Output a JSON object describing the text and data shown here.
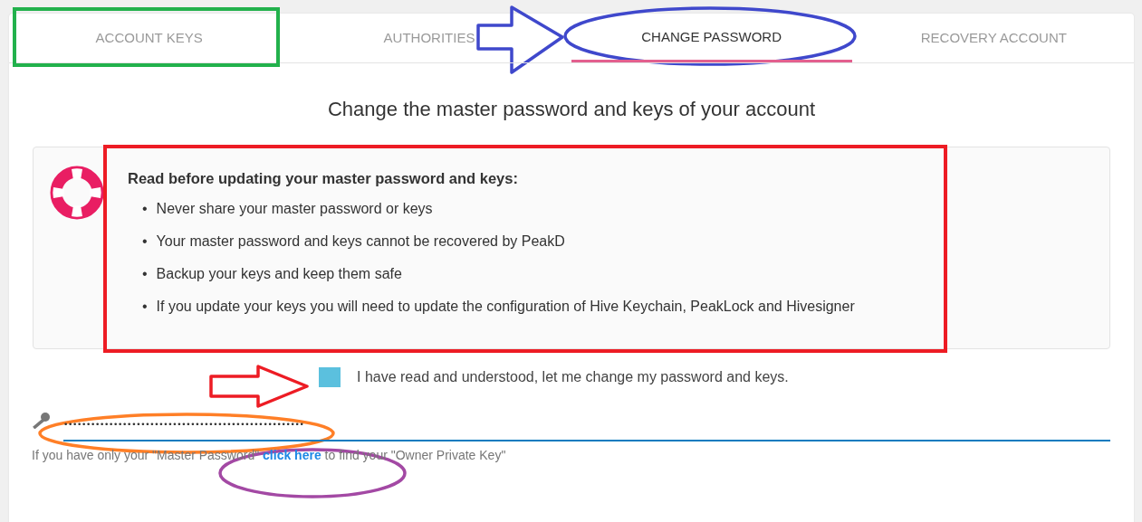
{
  "tabs": [
    {
      "label": "ACCOUNT KEYS",
      "selected": false
    },
    {
      "label": "AUTHORITIES",
      "selected": false
    },
    {
      "label": "CHANGE PASSWORD",
      "selected": true
    },
    {
      "label": "RECOVERY ACCOUNT",
      "selected": false
    }
  ],
  "title": "Change the master password and keys of your account",
  "notice": {
    "heading": "Read before updating your master password and keys:",
    "bullet": "•",
    "items": [
      "Never share your master password or keys",
      "Your master password and keys cannot be recovered by PeakD",
      "Backup your keys and keep them safe",
      "If you update your keys you will need to update the configuration of Hive Keychain, PeakLock and Hivesigner"
    ]
  },
  "agree": {
    "label": "I have read and understood, let me change my password and keys.",
    "checked": true
  },
  "password_field": {
    "value": "•••••••••••••••••••••••••••••••••••••••••••••••••••••"
  },
  "help": {
    "before": "If you have only your \"Master Password\"",
    "link": "click here",
    "after": "to find your \"Owner Private Key\""
  },
  "annotations": [
    {
      "kind": "rect",
      "color": "#22b14c"
    },
    {
      "kind": "arrow",
      "color": "#3f48cc"
    },
    {
      "kind": "ellipse",
      "color": "#3f48cc"
    },
    {
      "kind": "rect",
      "color": "#ed1c24"
    },
    {
      "kind": "arrow",
      "color": "#ed1c24"
    },
    {
      "kind": "ellipse",
      "color": "#ff7f27"
    },
    {
      "kind": "ellipse",
      "color": "#a349a4"
    }
  ]
}
